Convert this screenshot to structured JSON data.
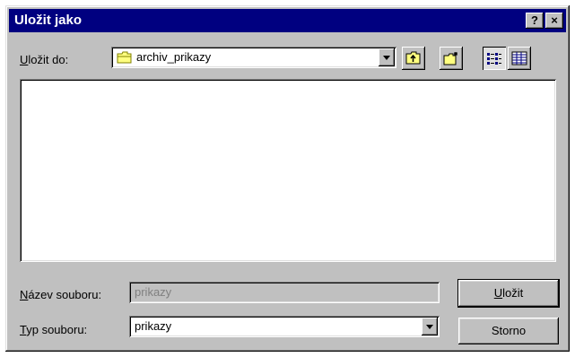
{
  "dialog": {
    "title": "Uložit jako",
    "help_label": "?",
    "close_label": "×"
  },
  "location": {
    "label_accel": "U",
    "label_rest": "ložit do:",
    "folder": "archiv_prikazy",
    "folder_icon": "folder-icon"
  },
  "toolbar": {
    "icons": [
      "up-one-level-icon",
      "new-folder-icon",
      "list-view-icon",
      "details-view-icon"
    ]
  },
  "filename": {
    "label_accel": "N",
    "label_rest": "ázev souboru:",
    "value": "prikazy"
  },
  "filetype": {
    "label_accel": "T",
    "label_rest": "yp souboru:",
    "value": "prikazy"
  },
  "buttons": {
    "save_accel": "U",
    "save_rest": "ložit",
    "cancel": "Storno"
  }
}
